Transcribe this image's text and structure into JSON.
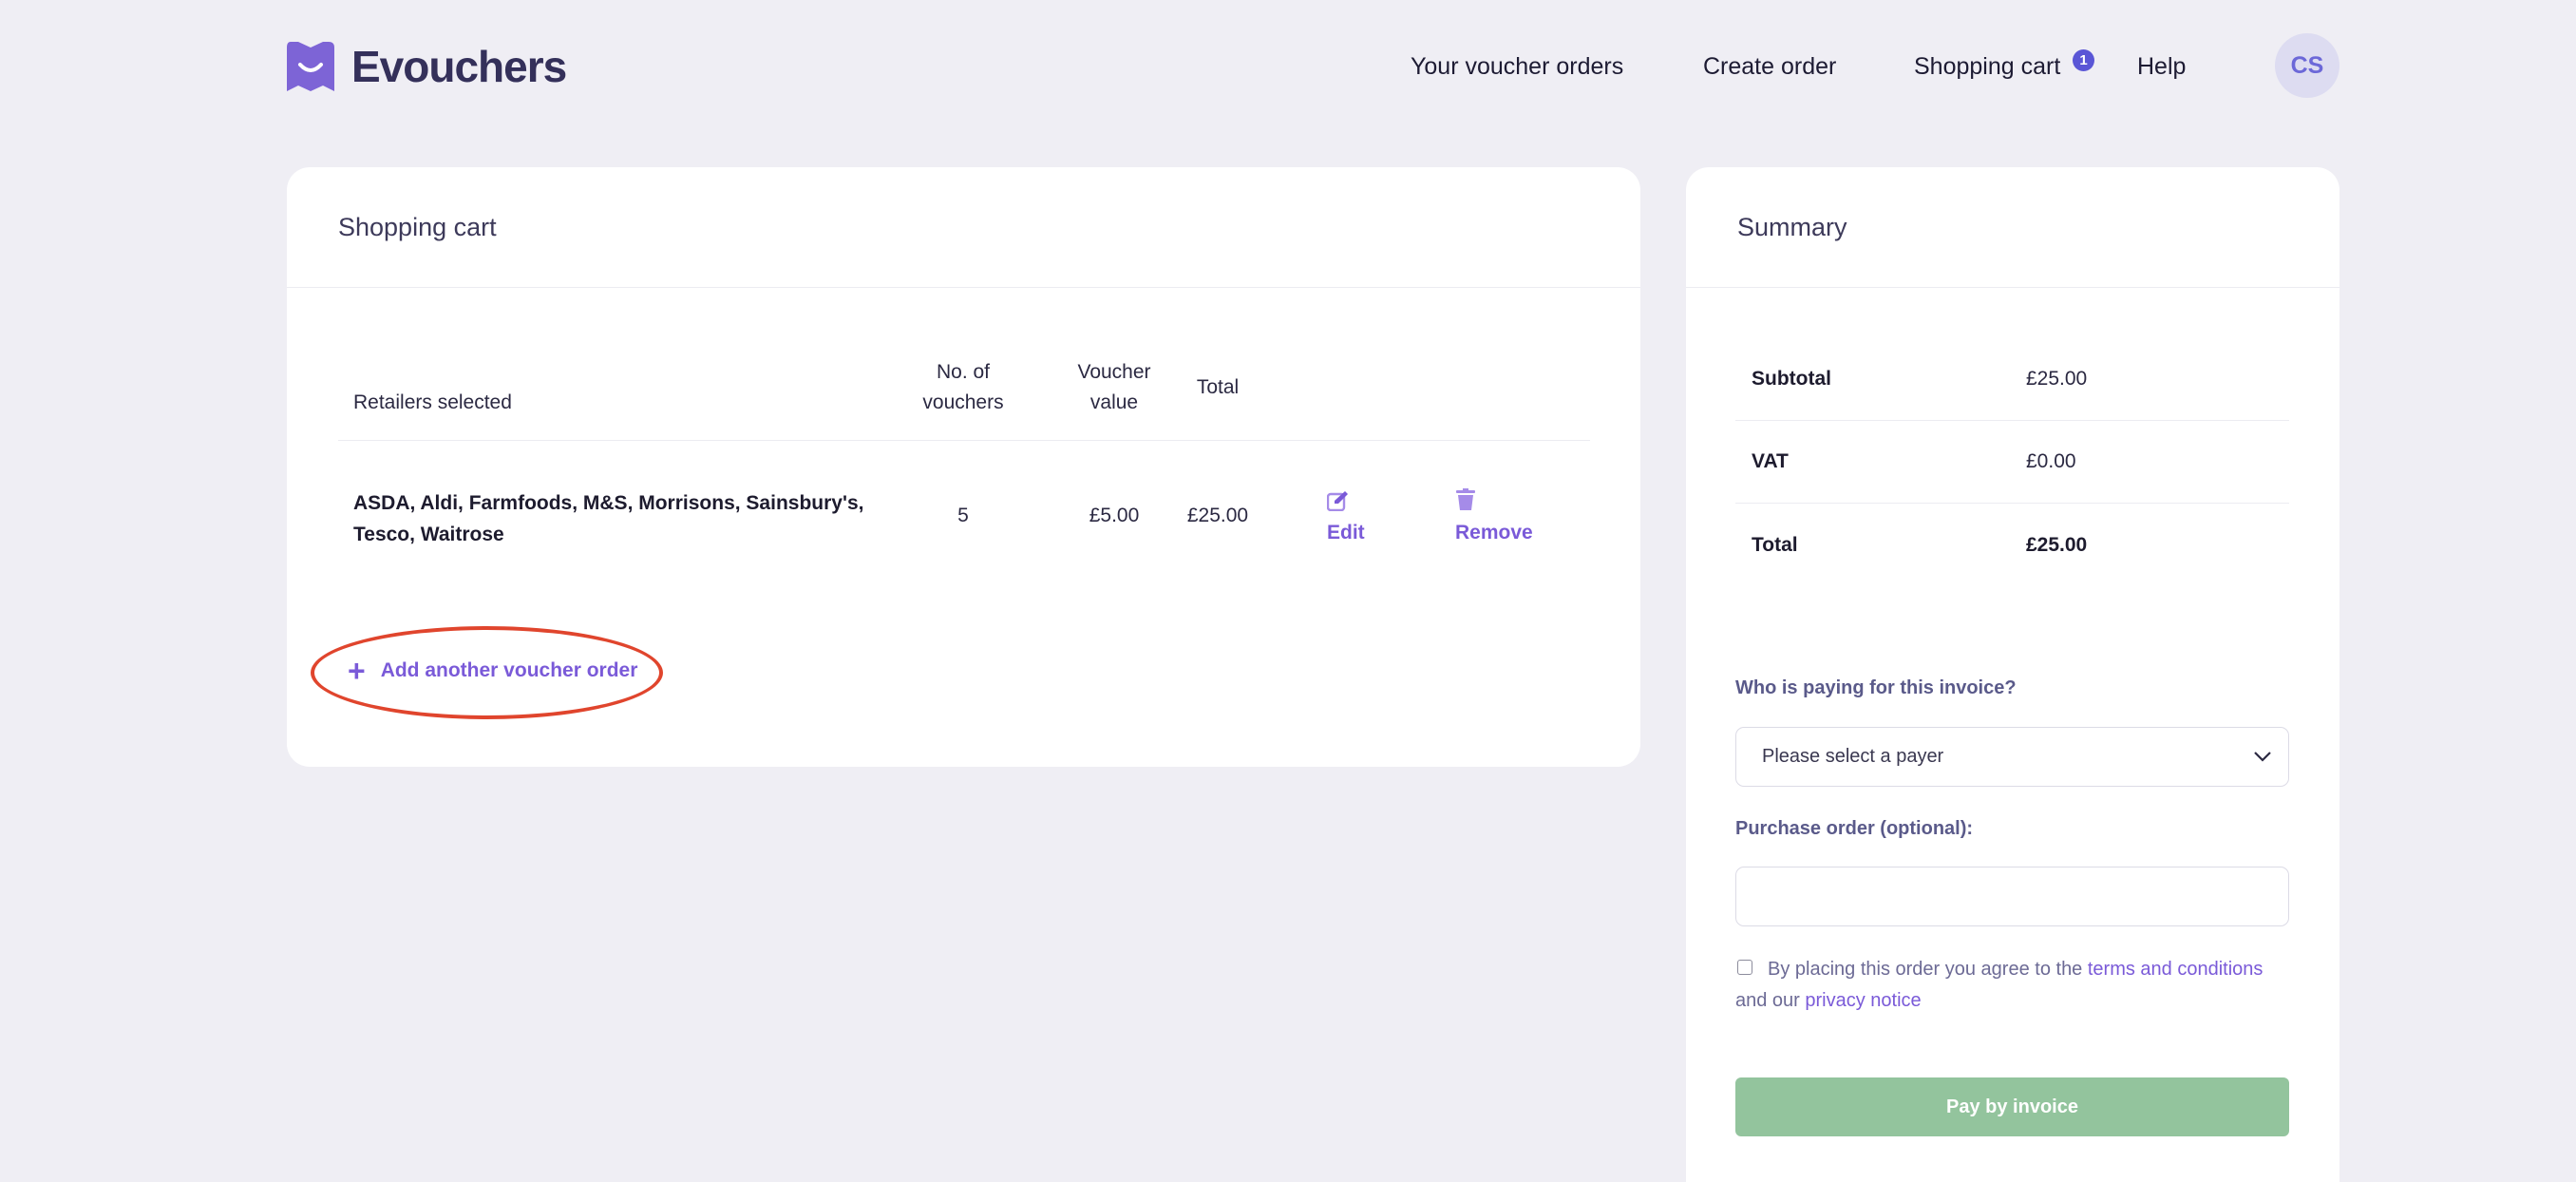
{
  "header": {
    "logo_text": "Evouchers",
    "nav": {
      "orders": "Your voucher orders",
      "create": "Create order",
      "cart": "Shopping cart",
      "cart_count": "1",
      "help": "Help"
    },
    "avatar_initials": "CS"
  },
  "cart": {
    "title": "Shopping cart",
    "columns": {
      "retailers": "Retailers selected",
      "num_vouchers": "No. of vouchers",
      "voucher_value": "Voucher value",
      "total": "Total"
    },
    "rows": [
      {
        "retailers": "ASDA, Aldi, Farmfoods, M&S, Morrisons, Sainsbury's, Tesco, Waitrose",
        "num_vouchers": "5",
        "voucher_value": "£5.00",
        "total": "£25.00",
        "edit_label": "Edit",
        "remove_label": "Remove"
      }
    ],
    "add_link": "Add another voucher order",
    "add_icon": "+"
  },
  "summary": {
    "title": "Summary",
    "subtotal_label": "Subtotal",
    "subtotal_value": "£25.00",
    "vat_label": "VAT",
    "vat_value": "£0.00",
    "total_label": "Total",
    "total_value": "£25.00",
    "payer_label": "Who is paying for this invoice?",
    "payer_placeholder": "Please select a payer",
    "po_label": "Purchase order (optional):",
    "terms_prefix": "By placing this order you agree to the ",
    "terms_link": "terms and conditions",
    "terms_middle": " and our ",
    "privacy_link": "privacy notice",
    "pay_button": "Pay by invoice"
  },
  "colors": {
    "accent": "#7a5ad8",
    "badge": "#5a56d6",
    "pay_button": "#93c49d",
    "highlight": "#e0452d",
    "background": "#efeef4"
  }
}
